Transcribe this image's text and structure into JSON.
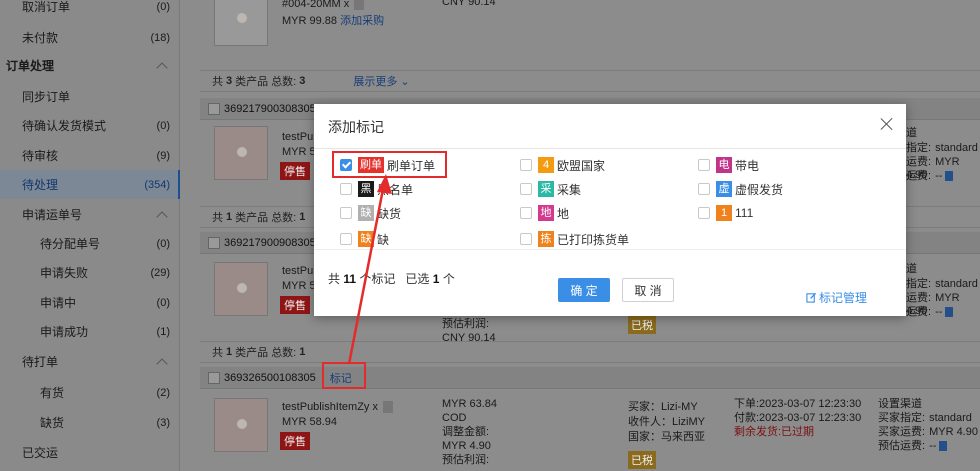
{
  "sidebar": {
    "items": [
      {
        "label": "取消订单",
        "count": "(0)"
      },
      {
        "label": "未付款",
        "count": "(18)"
      },
      {
        "label": "订单处理",
        "count": ""
      },
      {
        "label": "同步订单",
        "count": ""
      },
      {
        "label": "待确认发货模式",
        "count": "(0)"
      },
      {
        "label": "待审核",
        "count": "(9)"
      },
      {
        "label": "待处理",
        "count": "(354)"
      },
      {
        "label": "申请运单号",
        "count": ""
      },
      {
        "label": "待分配单号",
        "count": "(0)"
      },
      {
        "label": "申请失败",
        "count": "(29)"
      },
      {
        "label": "申请中",
        "count": "(0)"
      },
      {
        "label": "申请成功",
        "count": "(1)"
      },
      {
        "label": "待打单",
        "count": ""
      },
      {
        "label": "有货",
        "count": "(2)"
      },
      {
        "label": "缺货",
        "count": "(3)"
      },
      {
        "label": "已交运",
        "count": ""
      }
    ]
  },
  "orders": {
    "top": {
      "sku": "#004-20MM",
      "qty": "x",
      "price": "MYR 99.88",
      "add_purchase": "添加采购",
      "amount_cny": "CNY 90.14",
      "summary_prefix": "共",
      "summary_types": "3",
      "summary_mid": "类产品",
      "summary_total_label": "总数:",
      "summary_total": "3",
      "show_more": "展示更多"
    },
    "o1": {
      "id": "369217900308305",
      "name": "testPu",
      "price": "MYR 5",
      "stop_tag": "停售",
      "summary_types": "1",
      "summary_total": "1",
      "right_link": "道",
      "right_l2": "指定:",
      "right_l2v": "standard",
      "right_l3": "运费:",
      "right_l3v": "MYR 4.90",
      "right_l4": "运费:",
      "right_l4v": "--"
    },
    "o2": {
      "id": "369217900908305",
      "name": "testPu",
      "price": "MYR 5",
      "stop_tag": "停售",
      "estimate_label": "预估利润:",
      "estimate": "CNY 90.14",
      "tax_tag": "已税",
      "summary_types": "1",
      "summary_total": "1",
      "right_link": "道",
      "right_l2": "指定:",
      "right_l2v": "standard",
      "right_l3": "运费:",
      "right_l3v": "MYR 4.90",
      "right_l4": "运费:",
      "right_l4v": "--"
    },
    "o3": {
      "id": "369326500108305",
      "mark_link": "标记",
      "name": "testPublishItemZy",
      "qty": "x",
      "price": "MYR 58.94",
      "stop_tag": "停售",
      "amount": "MYR 63.84",
      "payment": "COD",
      "adjust_label": "调整金额:",
      "adjust": "MYR 4.90",
      "estimate_label": "预估利润:",
      "buyer": "买家：Lizi-MY",
      "receiver": "收件人：LiziMY",
      "country": "国家：马来西亚",
      "tax_tag": "已税",
      "order_time": "下单:2023-03-07 12:23:30",
      "pay_time": "付款:2023-03-07 12:23:30",
      "remaining": "剩余发货:已过期",
      "set_channel": "设置渠道",
      "buyer_spec": "买家指定:",
      "buyer_spec_v": "standard",
      "buyer_fee": "买家运费:",
      "buyer_fee_v": "MYR 4.90",
      "est_fee": "预估运费:",
      "est_fee_v": "--"
    }
  },
  "modal": {
    "title": "添加标记",
    "options": [
      {
        "badge": "刷单",
        "label": "刷单订单",
        "color": "#e5322d",
        "checked": true
      },
      {
        "badge": "4",
        "label": "欧盟国家",
        "color": "#f39c12",
        "checked": false
      },
      {
        "badge": "电",
        "label": "带电",
        "color": "#c2338a",
        "checked": false
      },
      {
        "badge": "黑",
        "label": "黑名单",
        "color": "#1a1a1a",
        "checked": false
      },
      {
        "badge": "采",
        "label": "采集",
        "color": "#2bb9a6",
        "checked": false
      },
      {
        "badge": "虚",
        "label": "虚假发货",
        "color": "#3a8ee6",
        "checked": false
      },
      {
        "badge": "缺",
        "label": "缺货",
        "color": "#b0b0b0",
        "checked": false
      },
      {
        "badge": "地",
        "label": "地",
        "color": "#d43b8f",
        "checked": false
      },
      {
        "badge": "1",
        "label": "111",
        "color": "#f0821e",
        "checked": false
      },
      {
        "badge": "缺",
        "label": "缺",
        "color": "#f0821e",
        "checked": false
      },
      {
        "badge": "拣",
        "label": "已打印拣货单",
        "color": "#f0821e",
        "checked": false
      }
    ],
    "total_prefix": "共",
    "total_count": "11",
    "total_suffix": "个标记",
    "selected_prefix": "已选",
    "selected_count": "1",
    "selected_suffix": "个",
    "confirm": "确 定",
    "cancel": "取 消",
    "manage": "标记管理"
  }
}
